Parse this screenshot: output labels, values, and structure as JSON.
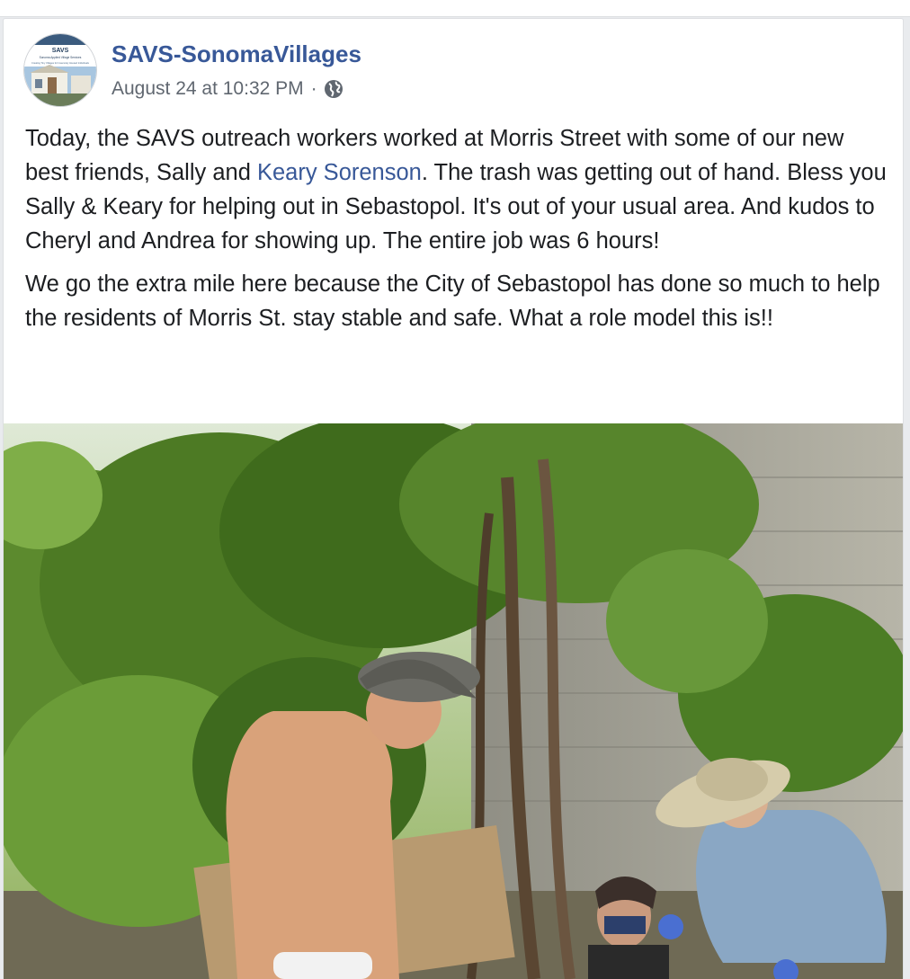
{
  "post": {
    "page_name": "SAVS-SonomaVillages",
    "timestamp": "August 24 at 10:32 PM",
    "separator": "·",
    "privacy_icon": "globe-icon",
    "avatar": {
      "logo_title": "SAVS",
      "logo_subtitle": "Sonoma Applied Village Services",
      "logo_tagline": "Creating Tiny Villages for Insecurely Housed Individuals"
    },
    "paragraph_1": {
      "before_mention": "Today, the SAVS outreach workers worked at Morris Street with some of our new best friends, Sally and ",
      "mention": "Keary Sorenson",
      "after_mention": ". The trash was getting out of hand. Bless you Sally & Keary for helping out in Sebastopol. It's out of your usual area. And kudos to Cheryl and Andrea for showing up. The entire job was 6 hours!"
    },
    "paragraph_2": "We go the extra mile here because the City of Sebastopol has done so much to help the residents of Morris St. stay stable and safe. What a role model this is!!"
  },
  "colors": {
    "link_blue": "#385898",
    "body_text": "#1c1e21",
    "meta_gray": "#606770",
    "page_background": "#e9ebee"
  }
}
